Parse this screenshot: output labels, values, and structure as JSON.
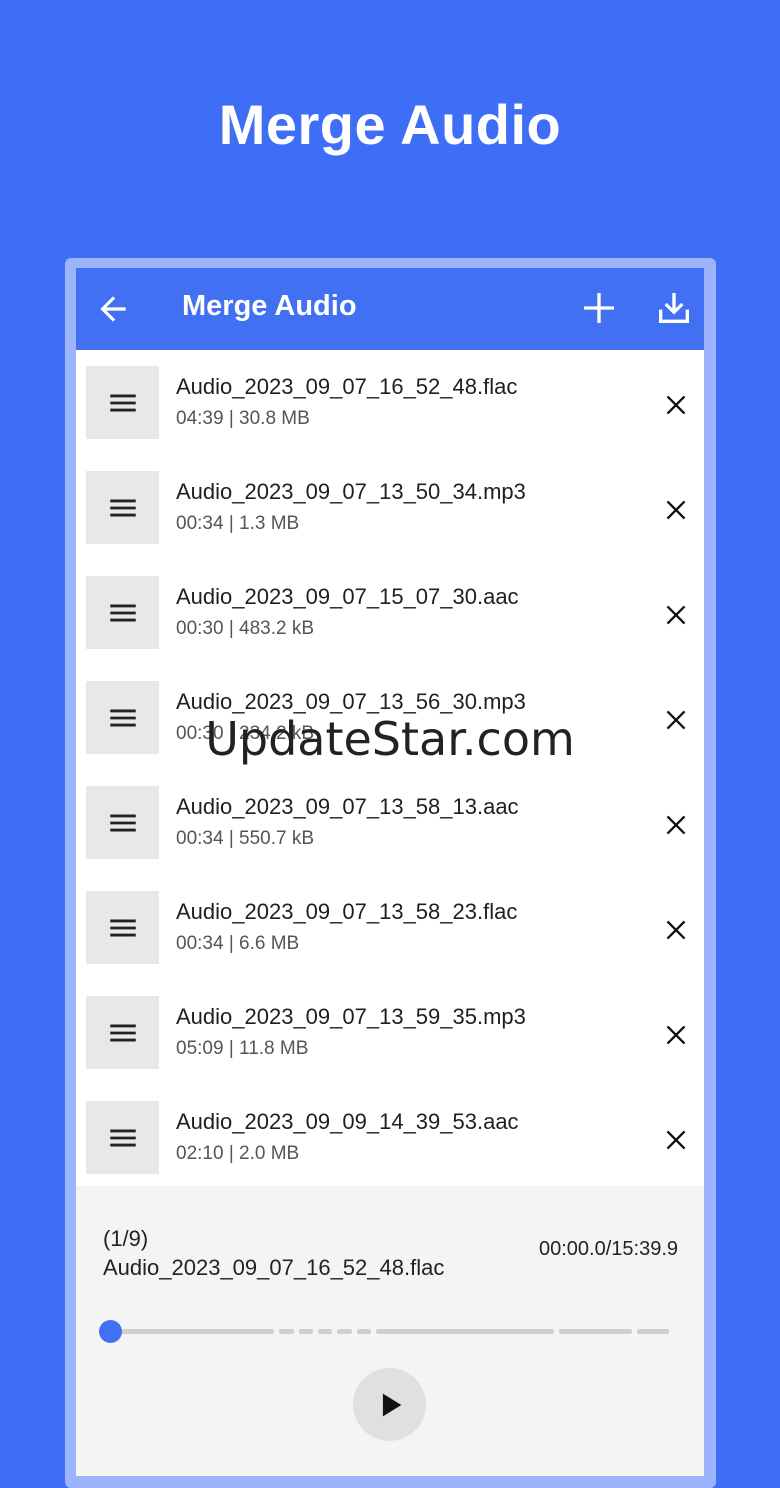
{
  "promo": {
    "title": "Merge Audio"
  },
  "appbar": {
    "title": "Merge Audio"
  },
  "files": [
    {
      "name": "Audio_2023_09_07_16_52_48.flac",
      "meta": "04:39 | 30.8 MB"
    },
    {
      "name": "Audio_2023_09_07_13_50_34.mp3",
      "meta": "00:34 | 1.3 MB"
    },
    {
      "name": "Audio_2023_09_07_15_07_30.aac",
      "meta": "00:30 | 483.2 kB"
    },
    {
      "name": "Audio_2023_09_07_13_56_30.mp3",
      "meta": "00:30 | 234.2 kB"
    },
    {
      "name": "Audio_2023_09_07_13_58_13.aac",
      "meta": "00:34 | 550.7 kB"
    },
    {
      "name": "Audio_2023_09_07_13_58_23.flac",
      "meta": "00:34 | 6.6 MB"
    },
    {
      "name": "Audio_2023_09_07_13_59_35.mp3",
      "meta": "05:09 | 11.8 MB"
    },
    {
      "name": "Audio_2023_09_09_14_39_53.aac",
      "meta": "02:10 | 2.0 MB"
    }
  ],
  "player": {
    "now_playing": "(1/9) Audio_2023_09_07_16_52_48.flac",
    "time": "00:00.0/15:39.9",
    "progress": 0
  },
  "watermark": "UpdateStar.com",
  "colors": {
    "background": "#3f6ef6",
    "appbar": "#4270f2",
    "accent": "#4270f2"
  }
}
